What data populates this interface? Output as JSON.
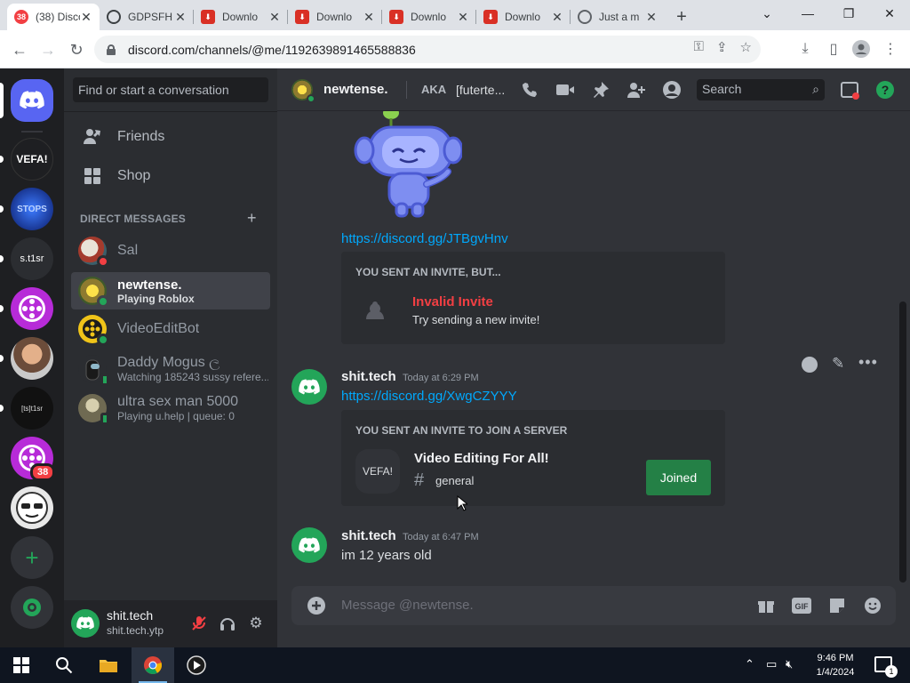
{
  "browser": {
    "tabs": [
      {
        "title": "(38) Discord",
        "badge": "38",
        "active": true
      },
      {
        "title": "GDPSFH",
        "active": false
      },
      {
        "title": "Downlo",
        "active": false
      },
      {
        "title": "Downlo",
        "active": false
      },
      {
        "title": "Downlo",
        "active": false
      },
      {
        "title": "Downlo",
        "active": false
      },
      {
        "title": "Just a m",
        "active": false
      }
    ],
    "url": "discord.com/channels/@me/1192639891465588836"
  },
  "guilds": {
    "items": [
      {
        "label": "VEFA!"
      },
      {
        "label": "STOPS"
      },
      {
        "label": "s.t1sr"
      },
      {
        "label": ""
      },
      {
        "label": ""
      },
      {
        "label": "[ts]t1sr"
      },
      {
        "label": "",
        "badge": "38"
      },
      {
        "label": ""
      }
    ]
  },
  "dm_sidebar": {
    "search_placeholder": "Find or start a conversation",
    "nav": [
      {
        "label": "Friends"
      },
      {
        "label": "Shop"
      }
    ],
    "header": "DIRECT MESSAGES",
    "dms": [
      {
        "name": "Sal",
        "sub": "",
        "status": "dnd"
      },
      {
        "name": "newtense.",
        "sub": "Playing Roblox",
        "status": "online",
        "selected": true
      },
      {
        "name": "VideoEditBot",
        "sub": "",
        "status": "online"
      },
      {
        "name": "Daddy Mogus ල",
        "sub": "Watching 185243 sussy refere...",
        "status": "mobile"
      },
      {
        "name": "ultra sex man 5000",
        "sub": "Playing u.help | queue: 0",
        "status": "mobile"
      }
    ]
  },
  "user_panel": {
    "username": "shit.tech",
    "tag": "shit.tech.ytp"
  },
  "chat": {
    "recipient": "newtense.",
    "aka_label": "AKA",
    "aka_value": "[futerte...",
    "search_placeholder": "Search",
    "link1": "https://discord.gg/JTBgvHnv",
    "invalid_embed": {
      "header": "YOU SENT AN INVITE, BUT...",
      "title": "Invalid Invite",
      "desc": "Try sending a new invite!"
    },
    "messages": [
      {
        "author": "shit.tech",
        "time": "Today at 6:29 PM",
        "link": "https://discord.gg/XwgCZYYY"
      },
      {
        "author": "shit.tech",
        "time": "Today at 6:47 PM",
        "text": "im 12 years old"
      }
    ],
    "invite_embed": {
      "header": "YOU SENT AN INVITE TO JOIN A SERVER",
      "icon_text": "VEFA!",
      "server": "Video Editing For All!",
      "channel": "general",
      "button": "Joined"
    },
    "composer_placeholder": "Message @newtense."
  },
  "taskbar": {
    "time": "9:46 PM",
    "date": "1/4/2024"
  },
  "colors": {
    "blurple": "#5865f2",
    "green": "#23a559",
    "red": "#f23f43",
    "link": "#00a8fc"
  }
}
